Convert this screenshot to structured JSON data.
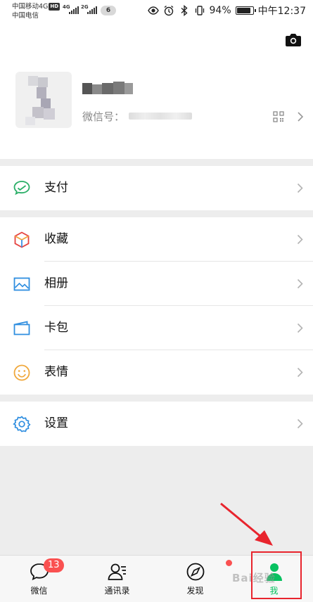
{
  "status_bar": {
    "carrier1": "中国移动4G",
    "carrier1_badge": "HD",
    "carrier2": "中国电信",
    "net1": "4G",
    "net2": "2G",
    "notification_count": "6",
    "battery": "94%",
    "battery_level": 0.94,
    "time": "中午12:37"
  },
  "profile": {
    "wechat_id_label": "微信号："
  },
  "groups": [
    {
      "items": [
        {
          "label": "支付",
          "icon": "pay-icon"
        }
      ]
    },
    {
      "items": [
        {
          "label": "收藏",
          "icon": "favorites-icon"
        },
        {
          "label": "相册",
          "icon": "album-icon"
        },
        {
          "label": "卡包",
          "icon": "card-wallet-icon"
        },
        {
          "label": "表情",
          "icon": "sticker-icon"
        }
      ]
    },
    {
      "items": [
        {
          "label": "设置",
          "icon": "settings-icon"
        }
      ]
    }
  ],
  "tabbar": {
    "tabs": [
      {
        "label": "微信",
        "icon": "chat-bubble-icon",
        "badge": "13"
      },
      {
        "label": "通讯录",
        "icon": "contacts-icon"
      },
      {
        "label": "发现",
        "icon": "compass-icon",
        "dot": true
      },
      {
        "label": "我",
        "icon": "me-icon",
        "active": true
      }
    ]
  },
  "colors": {
    "accent_green": "#07c160",
    "badge_red": "#fa5151",
    "annotation_red": "#e8242d"
  },
  "watermark_text": "Bai经验"
}
